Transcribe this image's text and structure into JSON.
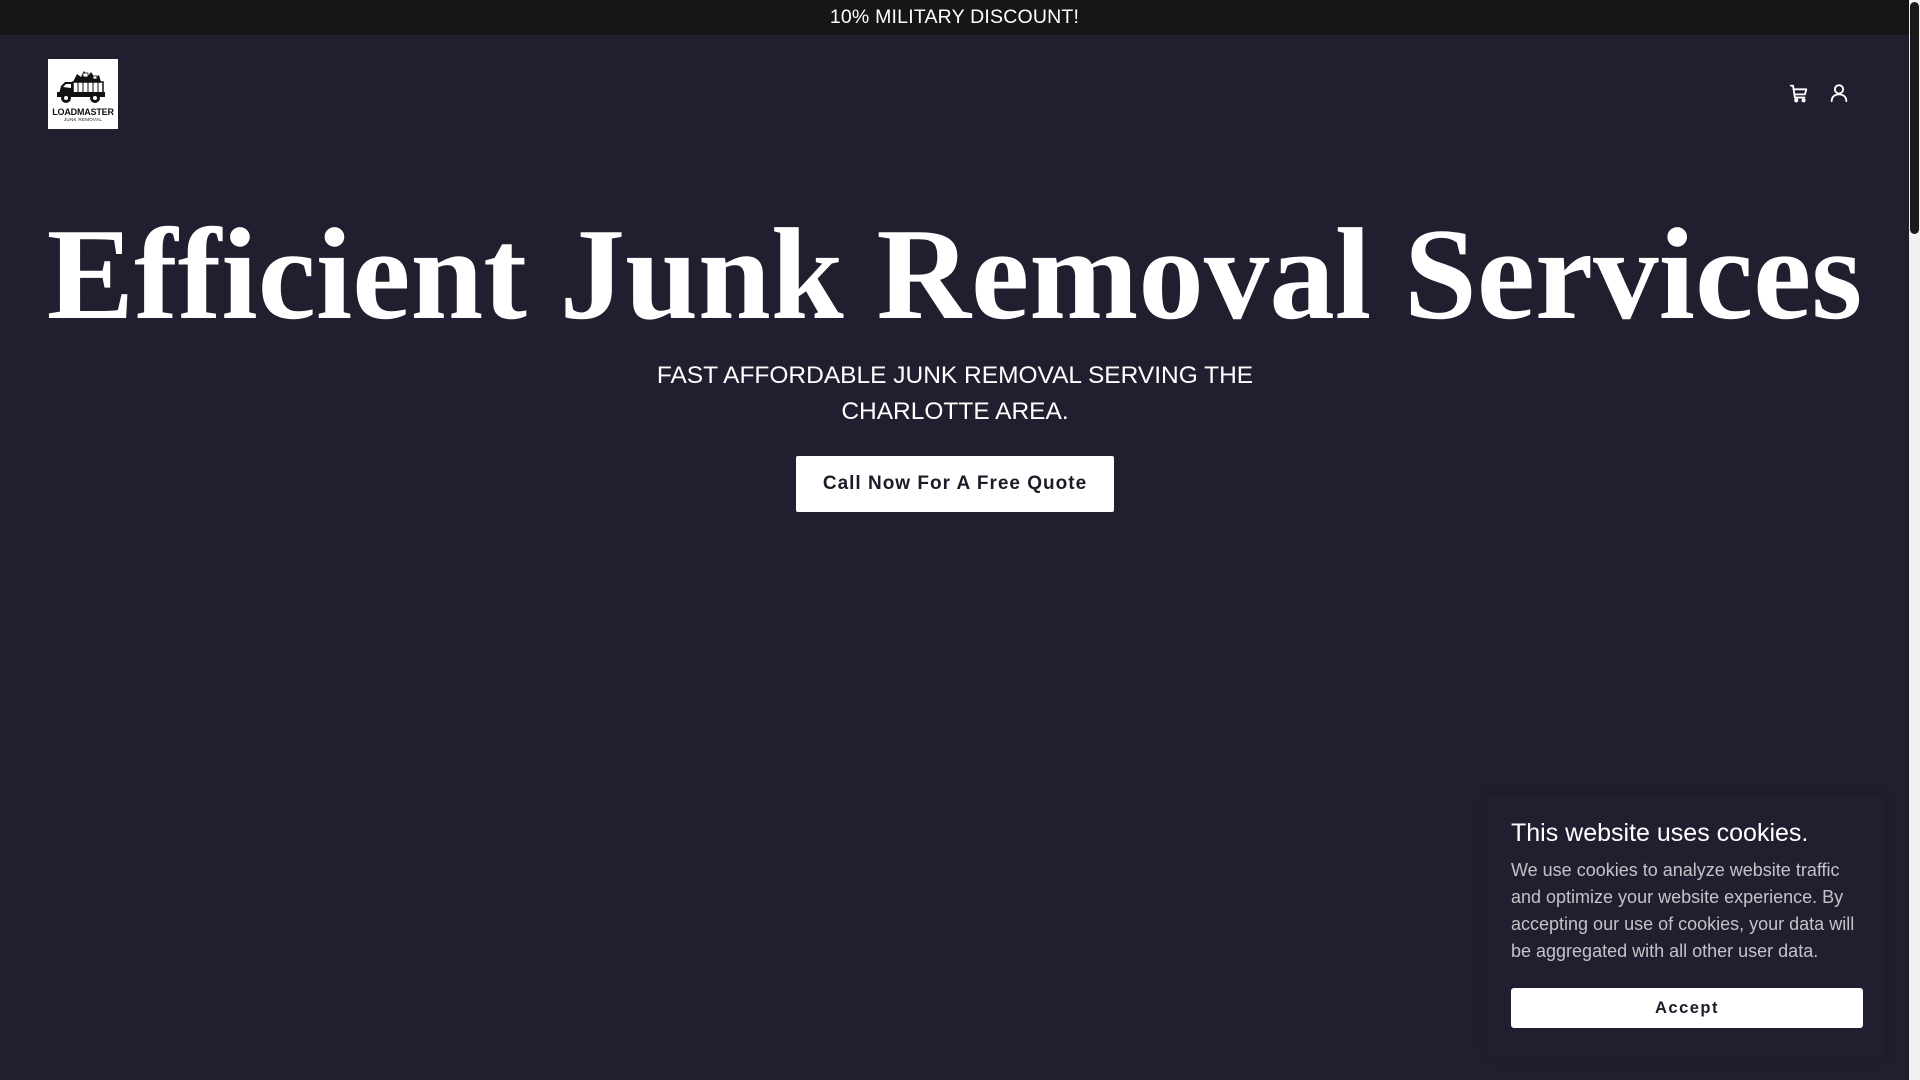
{
  "announcement": {
    "text": "10% MILITARY DISCOUNT!"
  },
  "header": {
    "logo": {
      "title": "LOADMASTER",
      "subtitle": "JUNK REMOVAL"
    },
    "icons": [
      "cart-icon",
      "account-icon"
    ]
  },
  "hero": {
    "title": "Efficient Junk Removal Services",
    "subtitle": "FAST AFFORDABLE JUNK REMOVAL SERVING THE CHARLOTTE AREA.",
    "cta_label": "Call Now For A Free Quote"
  },
  "cookie_banner": {
    "title": "This website uses cookies.",
    "body": "We use cookies to analyze website traffic and optimize your website experience. By accepting our use of cookies, your data will be aggregated with all other user data.",
    "accept_label": "Accept"
  },
  "colors": {
    "background": "#1f1f2f",
    "announcement_bar": "#161616",
    "text": "#ffffff",
    "button_bg": "#ffffff",
    "button_text": "#1c1c28"
  }
}
